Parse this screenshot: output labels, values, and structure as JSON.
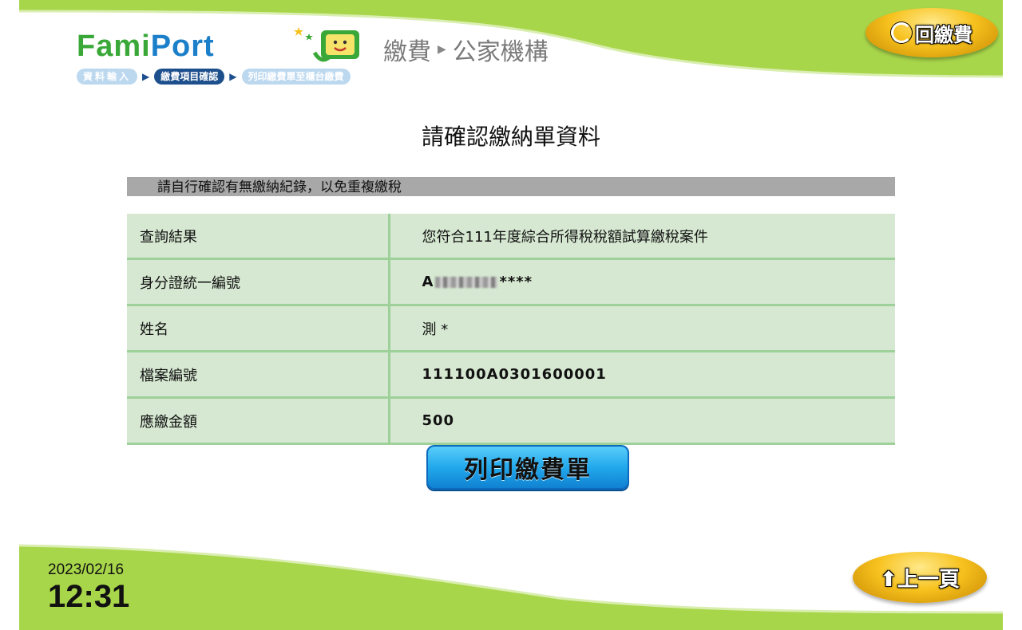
{
  "header": {
    "logo_fami": "Fami",
    "logo_port": "Port",
    "section_primary": "繳費",
    "section_secondary": "公家機構",
    "back_pay_label": "回繳費"
  },
  "breadcrumb": {
    "steps": [
      {
        "label": "資料輸入",
        "state": "inactive"
      },
      {
        "label": "繳費項目確認",
        "state": "active"
      },
      {
        "label": "列印繳費單至櫃台繳費",
        "state": "inactive"
      }
    ]
  },
  "main": {
    "title": "請確認繳納單資料",
    "notice": "請自行確認有無繳納紀錄，以免重複繳稅",
    "rows": [
      {
        "label": "查詢結果",
        "value": "您符合111年度綜合所得稅稅額試算繳稅案件"
      },
      {
        "label": "身分證統一編號",
        "value_prefix": "A",
        "value_suffix": "****"
      },
      {
        "label": "姓名",
        "value": "測 *"
      },
      {
        "label": "檔案編號",
        "value": "111100A0301600001"
      },
      {
        "label": "應繳金額",
        "value": "500"
      }
    ],
    "print_button": "列印繳費單"
  },
  "footer": {
    "date": "2023/02/16",
    "time": "12:31",
    "prev_label": "上一頁"
  },
  "colors": {
    "wave_green": "#a8d64a",
    "table_bg": "#d6e8d1",
    "table_border": "#9ed19a",
    "notice_bg": "#a8a8a8",
    "print_button": "#22a8ec",
    "gold_button": "#f7c21e"
  }
}
